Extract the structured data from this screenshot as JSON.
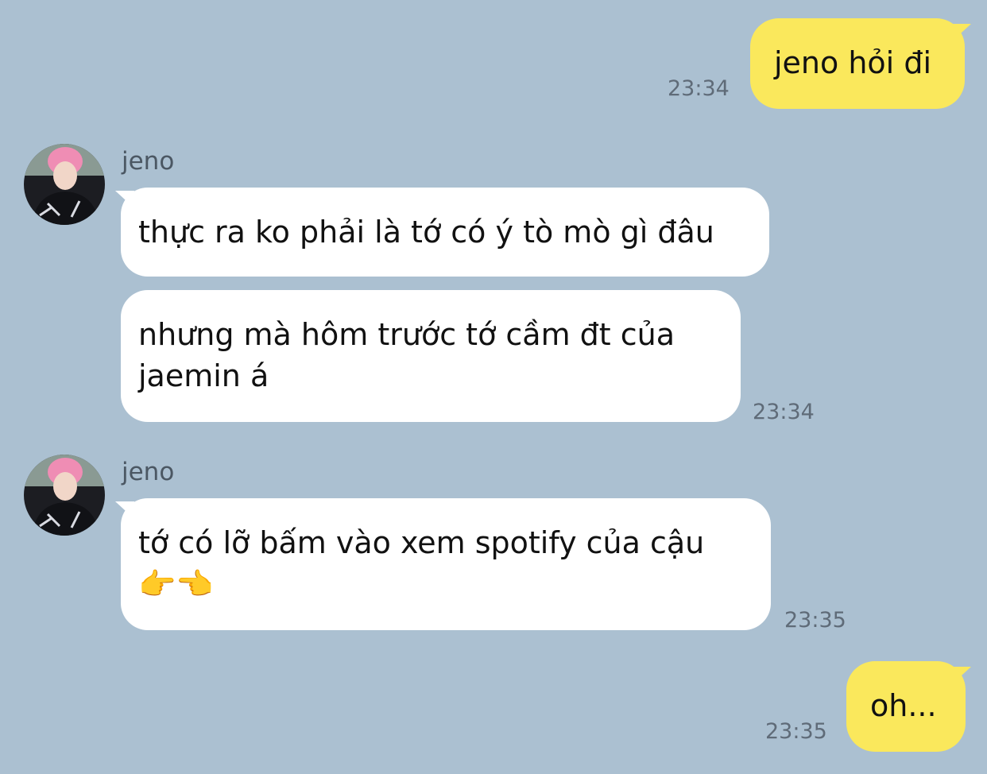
{
  "messages": [
    {
      "direction": "outgoing",
      "text": "jeno hỏi đi",
      "time": "23:34"
    },
    {
      "direction": "incoming",
      "sender": "jeno",
      "avatar": "profile-photo",
      "bubbles": [
        {
          "text": "thực ra ko phải là tớ có ý tò mò gì đâu"
        },
        {
          "text": "nhưng mà hôm trước tớ cầm đt của jaemin á"
        }
      ],
      "time": "23:34"
    },
    {
      "direction": "incoming",
      "sender": "jeno",
      "avatar": "profile-photo",
      "bubbles": [
        {
          "text": "tớ có lỡ bấm vào xem spotify của cậu",
          "emoji": "👉👈"
        }
      ],
      "time": "23:35"
    },
    {
      "direction": "outgoing",
      "text": "oh...",
      "time": "23:35"
    }
  ],
  "colors": {
    "background": "#abc0d1",
    "outgoing_bubble": "#fae85c",
    "incoming_bubble": "#ffffff"
  }
}
